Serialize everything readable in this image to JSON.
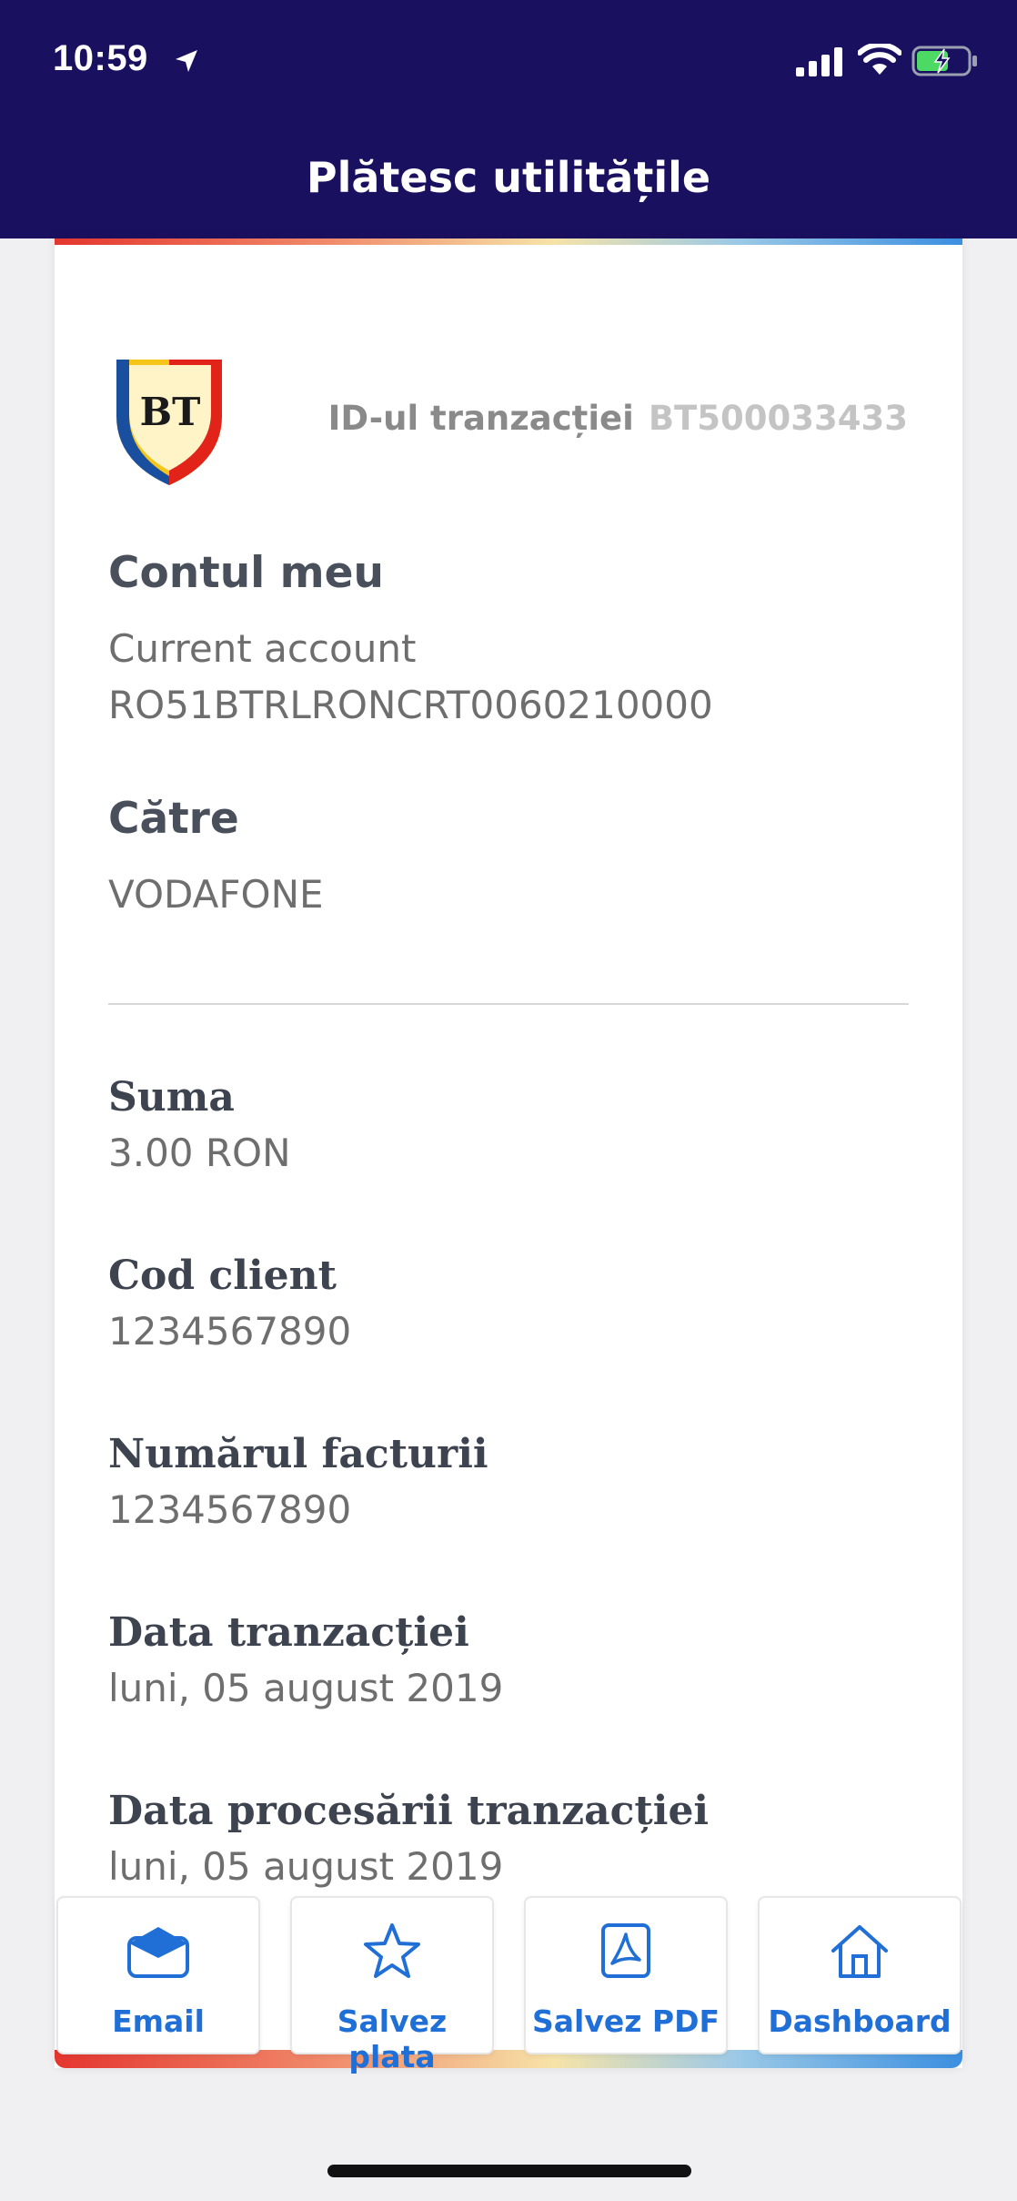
{
  "status_bar": {
    "time": "10:59",
    "icons": [
      "location-arrow-icon",
      "cellular-signal-icon",
      "wifi-icon",
      "battery-charging-icon"
    ]
  },
  "header": {
    "title": "Plătesc utilitățile"
  },
  "transaction": {
    "id_label": "ID-ul tranzacției",
    "id_value": "BT500033433"
  },
  "from": {
    "title": "Contul meu",
    "account_type": "Current account",
    "iban": "RO51BTRLRONCRT0060210000"
  },
  "to": {
    "title": "Către",
    "name": "VODAFONE"
  },
  "details": [
    {
      "label": "Suma",
      "value": "3.00 RON"
    },
    {
      "label": "Cod client",
      "value": "1234567890"
    },
    {
      "label": "Numărul facturii",
      "value": "1234567890"
    },
    {
      "label": "Data tranzacției",
      "value": "luni, 05 august 2019"
    },
    {
      "label": "Data procesării tranzacției",
      "value": "luni, 05 august 2019"
    }
  ],
  "actions": [
    {
      "label": "Email",
      "icon": "email-icon"
    },
    {
      "label": "Salvez plata",
      "icon": "star-icon"
    },
    {
      "label": "Salvez PDF",
      "icon": "pdf-icon"
    },
    {
      "label": "Dashboard",
      "icon": "home-icon"
    }
  ],
  "colors": {
    "header_bg": "#1a1060",
    "accent_blue": "#1f6fd6",
    "label_color": "#3e4350",
    "value_color": "#6e6e6e"
  }
}
